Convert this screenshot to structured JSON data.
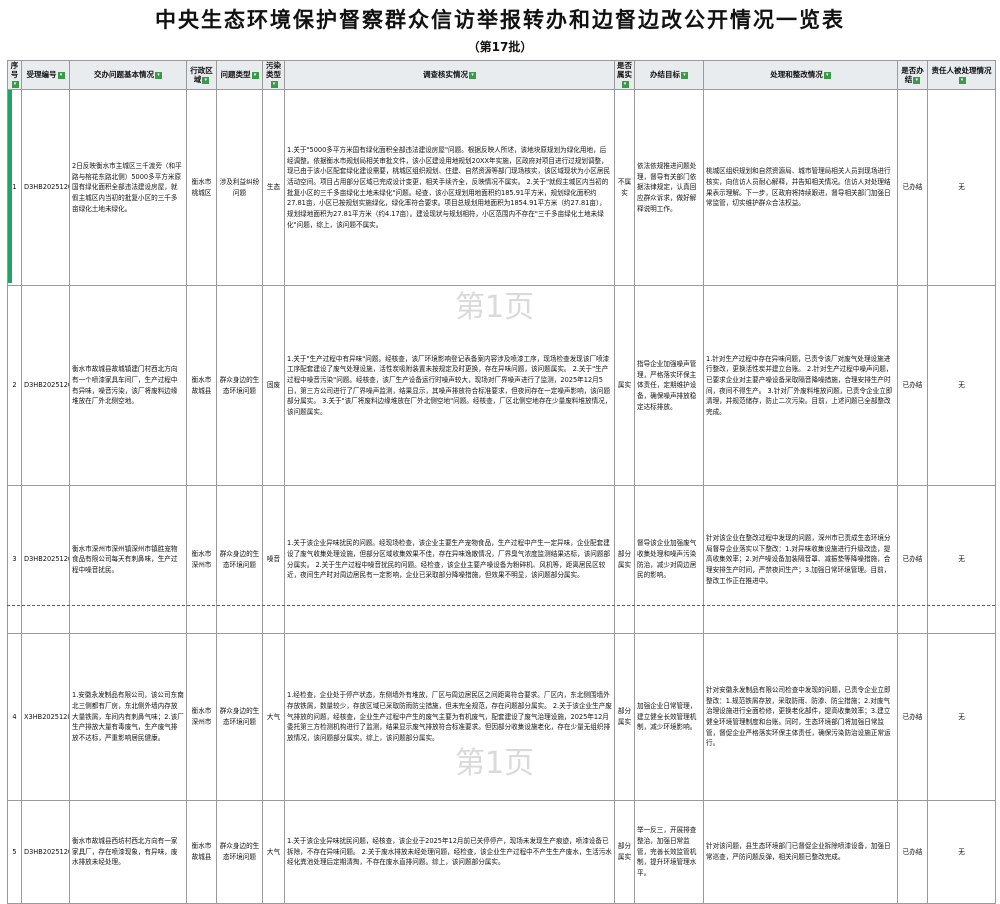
{
  "header": {
    "title": "中央生态环境保护督察群众信访举报转办和边督边改公开情况一览表",
    "subtitle": "（第17批）"
  },
  "watermarks": [
    "第1页",
    "第1页"
  ],
  "columns": [
    "序号",
    "受理编号",
    "交办问题基本情况",
    "行政区域",
    "问题类型",
    "污染类型",
    "调查核实情况",
    "是否属实",
    "办结目标",
    "处理和整改情况",
    "是否办结",
    "责任人被处理情况"
  ],
  "rows": [
    {
      "no": "1",
      "id": "D3HB202512030053",
      "issue": "2日反映衡水市主城区三千渡旁（和平路与榕花东路北侧）5000多平方米原国有绿化面积全部违法建设房屋，就假主城区内当初的批复小区的三千多亩绿化土地未绿化。",
      "region": "衡水市桃城区",
      "type": "涉及利益纠纷问题",
      "pollution": "生态",
      "findings": "1.关于\"5000多平方米国有绿化面积全部违法建设房屋\"问题。根据反映人所述，该地块原规划为绿化用地，后经调整。依据衡水市规划局相关审批文件，该小区建设用地规划20XX年实施，区政府对项目进行过规划调整，现已由于该小区配套绿化建设需要，桃城区组织规划、住建、自然资源等部门现场核实，该区域现状为小区居民活动空间。项目占用部分区域已完成设计变更，相关手续齐全，反映情况不属实。\n2.关于\"就假主城区内当初的批复小区的三千多亩绿化土地未绿化\"问题。经查，该小区规划用地面积约185.91平方米，规划绿化面积约27.81亩，小区已按规划实施绿化，绿化率符合要求。项目总规划用地面积为1854.91平方米（约27.81亩），规划绿地面积为27.81平方米（约4.17亩）。建设现状与规划相符，小区范围内不存在\"三千多亩绿化土地未绿化\"问题，综上，该问题不属实。",
      "true": "不属实",
      "goal": "依法依规推进问题处理，督导有关部门依据法律规定，认真回应群众诉求，做好解释说明工作。",
      "handling": "桃城区组织规划和自然资源局、城市管理局相关人员到现场进行核实，向信访人员耐心解释，并告知相关情况。信访人对处理结果表示理解。下一步，区政府将持续跟进，督导相关部门加强日常监管，切实维护群众合法权益。",
      "done": "已办结",
      "penalty": "无"
    },
    {
      "no": "2",
      "id": "D3HB202512030040",
      "issue": "衡水市故城县故城镇建门村西北方向有一个喷漆家具车间厂，生产过程中有异味，噪音污染，该厂将废料边缘堆放在厂外北侧空地。",
      "region": "衡水市故城县",
      "type": "群众身边的生态环境问题",
      "pollution": "固废",
      "findings": "1.关于\"生产过程中有异味\"问题。经核查，该厂环境影响登记表备案内容涉及喷漆工序，现场检查发现该厂喷漆工序配套建设了废气处理设施，活性炭吸附装置未按规定及时更换，存在异味问题，该问题属实。\n2.关于\"生产过程中噪音污染\"问题。经核查，该厂生产设备运行时噪声较大，现场对厂界噪声进行了监测，2025年12月5日，第三方公司进行了厂界噪声监测，结果显示，其噪声排放符合标准要求，但夜间存在一定噪声影响，该问题部分属实。\n3.关于\"该厂将废料边缘堆放在厂外北侧空地\"问题。经核查，厂区北侧空地存在少量废料堆放情况，该问题属实。",
      "true": "属实",
      "goal": "指导企业加强噪声管理，严格落实环保主体责任，定期维护设备，确保噪声排放稳定达标排放。",
      "handling": "1.针对生产过程中存在异味问题，已责令该厂对废气处理设施进行整改，更换活性炭并建立台账。\n2.针对生产过程中噪声问题，已要求企业对主要产噪设备采取隔音降噪措施，合理安排生产时间，夜间不得生产。\n3.针对厂外废料堆放问题，已责令企业立即清理，并规范储存，防止二次污染。目前，上述问题已全部整改完成。",
      "done": "已办结",
      "penalty": "无"
    },
    {
      "no": "3",
      "id": "D3HB202512030031",
      "issue": "衡水市深州市深州镇深州市镇胜宠物食品有限公司每天有刺鼻味，生产过程中噪音扰民。",
      "region": "衡水市深州市",
      "type": "群众身边的生态环境问题",
      "pollution": "噪音",
      "findings": "1.关于该企业异味扰民的问题。经现场检查，该企业主要生产宠物食品，生产过程中产生一定异味，企业配套建设了废气收集处理设施，但部分区域收集效果不佳，存在异味逸散情况，厂界臭气浓度监测结果达标，该问题部分属实。\n2.关于生产过程中噪音扰民的问题。经检查，该企业主要产噪设备为粉碎机、风机等，距离居民区较近，夜间生产时对周边居民有一定影响，企业已采取部分降噪措施，但效果不明显，该问题部分属实。",
      "true": "部分属实",
      "goal": "督导该企业加强废气收集处理和噪声污染防治，减少对周边居民的影响。",
      "handling": "针对该企业在整改过程中发现的问题，深州市已责成生态环境分局督导企业落实以下整改：1.对异味收集设施进行升级改造，提高收集效率；2.对产噪设备加装隔音罩、减振垫等降噪措施，合理安排生产时间，严禁夜间生产；3.加强日常环境管理。目前，整改工作正在推进中。",
      "done": "已办结",
      "penalty": "无"
    },
    {
      "no": "4",
      "id": "X3HB202512030013",
      "issue": "1.安徽永发制品有限公司，该公司东南北三侧都有厂房，东北侧外墙内存放大量铁屑，车间内有刺鼻气味；2.该厂生产排放大量有毒废气，生产废气排放不达标，严重影响居民健康。",
      "region": "衡水市深州市",
      "type": "群众身边的生态环境问题",
      "pollution": "大气",
      "findings": "1.经检查，企业处于停产状态，东侧墙外有堆放，厂区与周边居民区之间距离符合要求。厂区内，东北侧围墙外存放铁屑，数量较少，存放区域已采取防雨防尘措施，但未完全规范，存在问题部分属实。\n2.关于该企业生产废气排放的问题，经核查，企业生产过程中产生的废气主要为有机废气，配套建设了废气治理设施，2025年12月委托第三方检测机构进行了监测，结果显示废气排放符合标准要求。但因部分收集设施老化，存在少量无组织排放情况，该问题部分属实。综上，该问题部分属实。",
      "true": "部分属实",
      "goal": "加强企业日常管理，建立健全长效管理机制，减少环境影响。",
      "handling": "针对安徽永发制品有限公司检查中发现的问题，已责令企业立即整改：1.规范铁屑存放，采取防雨、防渗、防尘措施；2.对废气治理设施进行全面检修，更换老化部件，提高收集效率；3.建立健全环境管理制度和台账。同时，生态环境部门将加强日常监管，督促企业严格落实环保主体责任，确保污染防治设施正常运行。",
      "done": "已办结",
      "penalty": "无"
    },
    {
      "no": "5",
      "id": "D3HB202512030030",
      "issue": "衡水市故城县西坊村西北方向有一家家具厂，存在喷漆现象，有异味，废水排放未经处理。",
      "region": "衡水市故城县",
      "type": "群众身边的生态环境问题",
      "pollution": "大气",
      "findings": "1.关于该企业异味扰民问题，经核查，该企业于2025年12月前已关停停产，现场未发现生产痕迹，喷漆设备已拆除，不存在异味问题。\n2.关于废水排放未经处理问题，经检查，该企业生产过程中不产生生产废水，生活污水经化粪池处理后定期清掏，不存在废水直排问题。综上，该问题部分属实。",
      "true": "部分属实",
      "goal": "举一反三，开展排查整治，加强日常监管，完善长效监管机制，提升环境管理水平。",
      "handling": "针对该问题，县生态环境部门已督促企业拆除喷漆设备，加强日常巡查，严防问题反弹，相关问题已整改完成。",
      "done": "已办结",
      "penalty": "无"
    }
  ]
}
